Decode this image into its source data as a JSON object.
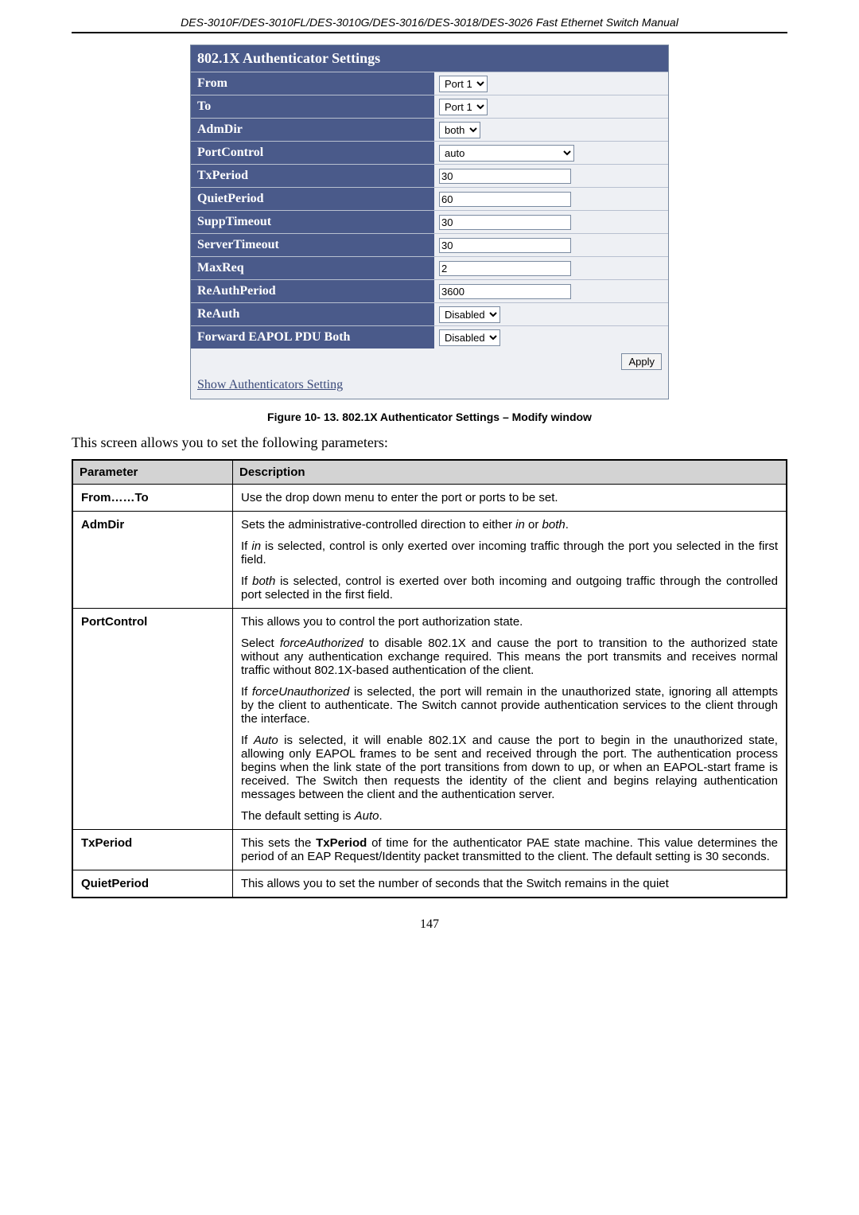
{
  "header": "DES-3010F/DES-3010FL/DES-3010G/DES-3016/DES-3018/DES-3026 Fast Ethernet Switch Manual",
  "settings": {
    "title": "802.1X Authenticator Settings",
    "rows": {
      "from": {
        "label": "From",
        "value": "Port 1"
      },
      "to": {
        "label": "To",
        "value": "Port 1"
      },
      "admdir": {
        "label": "AdmDir",
        "value": "both"
      },
      "portcontrol": {
        "label": "PortControl",
        "value": "auto"
      },
      "txperiod": {
        "label": "TxPeriod",
        "value": "30"
      },
      "quietperiod": {
        "label": "QuietPeriod",
        "value": "60"
      },
      "supptimeout": {
        "label": "SuppTimeout",
        "value": "30"
      },
      "servertimeout": {
        "label": "ServerTimeout",
        "value": "30"
      },
      "maxreq": {
        "label": "MaxReq",
        "value": "2"
      },
      "reauthperiod": {
        "label": "ReAuthPeriod",
        "value": "3600"
      },
      "reauth": {
        "label": "ReAuth",
        "value": "Disabled"
      },
      "forwardeapol": {
        "label": "Forward EAPOL PDU Both",
        "value": "Disabled"
      }
    },
    "apply": "Apply",
    "show_link": "Show Authenticators Setting"
  },
  "figure_caption": "Figure 10- 13. 802.1X Authenticator Settings – Modify window",
  "intro": "This screen allows you to set the following parameters:",
  "params_header": {
    "param": "Parameter",
    "desc": "Description"
  },
  "params": {
    "fromto": {
      "name": "From……To",
      "desc": "Use the drop down menu to enter the port or ports to be set."
    },
    "admdir": {
      "name": "AdmDir",
      "p1a": "Sets the administrative-controlled direction to either ",
      "p1b": "in",
      "p1c": " or ",
      "p1d": "both",
      "p1e": ".",
      "p2a": "If ",
      "p2b": "in",
      "p2c": " is selected, control is only exerted over incoming traffic through the port you selected in the first field.",
      "p3a": "If ",
      "p3b": "both",
      "p3c": " is selected, control is exerted over both incoming and outgoing traffic through the controlled port selected in the first field."
    },
    "portcontrol": {
      "name": "PortControl",
      "p1": "This allows you to control the port authorization state.",
      "p2a": "Select ",
      "p2b": "forceAuthorized",
      "p2c": " to disable 802.1X and cause the port to transition to the authorized state without any authentication exchange required. This means the port transmits and receives normal traffic without 802.1X-based authentication of the client.",
      "p3a": "If ",
      "p3b": "forceUnauthorized",
      "p3c": " is selected, the port will remain in the unauthorized state, ignoring all attempts by the client to authenticate. The Switch cannot provide authentication services to the client through the interface.",
      "p4a": "If ",
      "p4b": "Auto",
      "p4c": " is selected, it will enable 802.1X and cause the port to begin in the unauthorized state, allowing only EAPOL frames to be sent and received through the port. The authentication process begins when the link state of the port transitions from down to up, or when an EAPOL-start frame is received. The Switch then requests the identity of the client and begins relaying authentication messages between the client and the authentication server.",
      "p5a": "The default setting is ",
      "p5b": "Auto",
      "p5c": "."
    },
    "txperiod": {
      "name": "TxPeriod",
      "p1a": "This sets the ",
      "p1b": "TxPeriod",
      "p1c": " of time for the authenticator PAE state machine. This value determines the period of an EAP Request/Identity packet transmitted to the client. The default setting is 30 seconds."
    },
    "quietperiod": {
      "name": "QuietPeriod",
      "p1": "This allows you to set the number of seconds that the Switch remains in the quiet"
    }
  },
  "page_number": "147"
}
